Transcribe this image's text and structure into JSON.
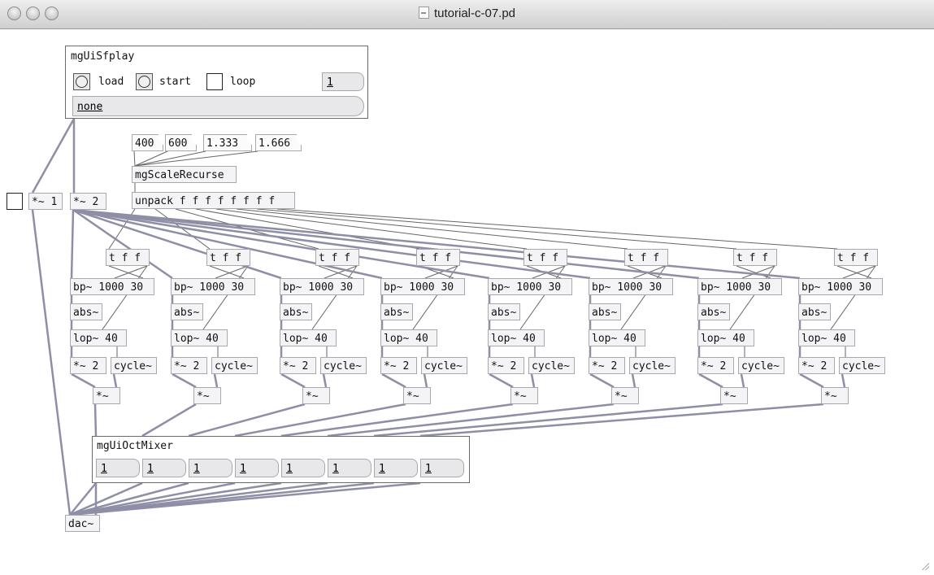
{
  "window": {
    "title": "tutorial-c-07.pd"
  },
  "sfplay": {
    "name": "mgUiSfplay",
    "load_label": "load",
    "start_label": "start",
    "loop_label": "loop",
    "number_value": "1",
    "symbol_value": "none"
  },
  "messages": [
    "400",
    "600",
    "1.333",
    "1.666"
  ],
  "objects": {
    "scale": "mgScaleRecurse",
    "unpack": "unpack f f f f f f f f",
    "mul1": "*~ 1",
    "mul2": "*~ 2",
    "dac": "dac~"
  },
  "voice": {
    "trigger": "t f f",
    "bp": "bp~ 1000 30",
    "abs": "abs~",
    "lop": "lop~ 40",
    "mul": "*~ 2",
    "cycle": "cycle~",
    "out": "*~"
  },
  "voices": [
    1,
    2,
    3,
    4,
    5,
    6,
    7,
    8
  ],
  "mixer": {
    "name": "mgUiOctMixer",
    "channels": [
      "1",
      "1",
      "1",
      "1",
      "1",
      "1",
      "1",
      "1"
    ]
  }
}
